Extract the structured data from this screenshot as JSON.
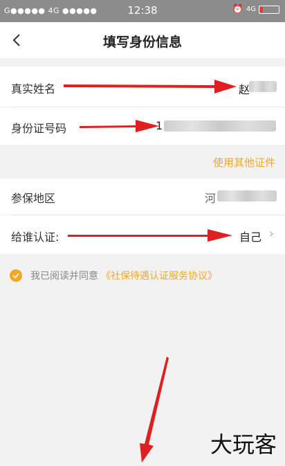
{
  "status_bar": {
    "left": "G●●●●● 4G ●●●●●",
    "time": "12:38",
    "network": "4G"
  },
  "navbar": {
    "title": "填写身份信息"
  },
  "form": {
    "name_label": "真实姓名",
    "name_value_visible": "赵",
    "id_label": "身份证号码",
    "id_value_visible": "1",
    "other_cert_link": "使用其他证件",
    "region_label": "参保地区",
    "region_value_visible": "河",
    "certify_for_label": "给谁认证:",
    "certify_for_value": "自己"
  },
  "agreement": {
    "prefix": "我已阅读并同意",
    "link": "《社保待遇认证服务协议》",
    "checked": true
  },
  "watermark": "大玩客",
  "colors": {
    "accent": "#f5a623",
    "arrow": "#e02020"
  }
}
